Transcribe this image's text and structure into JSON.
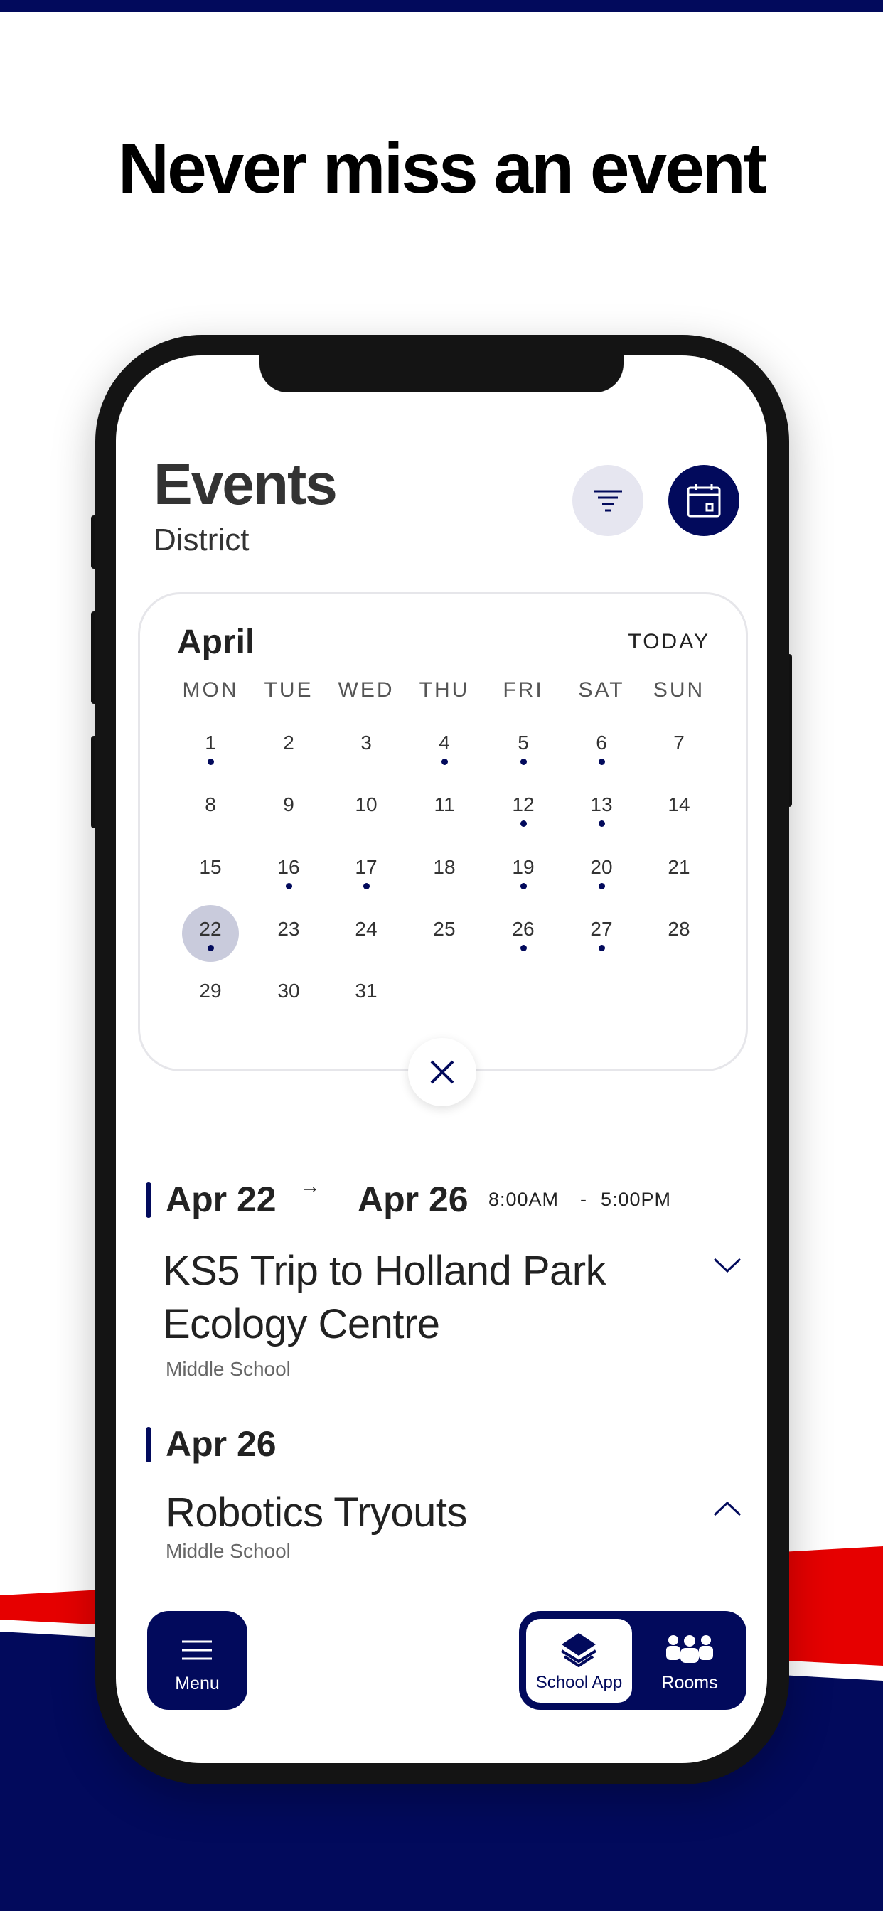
{
  "headline": "Never miss an event",
  "colors": {
    "navy": "#020a5c",
    "red": "#e60000",
    "selected_day": "#c9cbdc",
    "filter_bg": "#e6e6f0"
  },
  "header": {
    "title": "Events",
    "subtitle": "District",
    "filter_icon": "filter-icon",
    "calendar_icon": "calendar-icon"
  },
  "calendar": {
    "month": "April",
    "today_label": "TODAY",
    "weekdays": [
      "MON",
      "TUE",
      "WED",
      "THU",
      "FRI",
      "SAT",
      "SUN"
    ],
    "weeks": [
      [
        1,
        2,
        3,
        4,
        5,
        6,
        7
      ],
      [
        8,
        9,
        10,
        11,
        12,
        13,
        14
      ],
      [
        15,
        16,
        17,
        18,
        19,
        20,
        21
      ],
      [
        22,
        23,
        24,
        25,
        26,
        27,
        28
      ],
      [
        29,
        30,
        31
      ]
    ],
    "event_days": [
      1,
      4,
      5,
      6,
      12,
      13,
      16,
      17,
      19,
      20,
      22,
      26,
      27
    ],
    "selected_day": 22
  },
  "events": [
    {
      "start": "Apr 22",
      "arrow": "→",
      "end": "Apr 26",
      "time_start": "8:00AM",
      "time_sep": "-",
      "time_end": "5:00PM",
      "title_line1": "KS5 Trip to Holland Park",
      "title_line2": "Ecology Centre",
      "school": "Middle School",
      "expanded": false
    },
    {
      "start": "Apr 26",
      "title_line1": "Robotics Tryouts",
      "school": "Middle School",
      "expanded": true
    }
  ],
  "bottom_nav": {
    "menu": "Menu",
    "school_app": "School App",
    "rooms": "Rooms",
    "active": "School App"
  }
}
